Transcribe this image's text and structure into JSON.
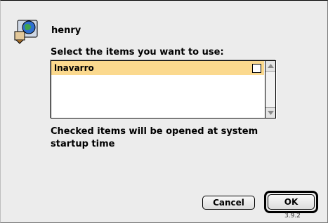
{
  "user": {
    "name": "henry"
  },
  "prompt": "Select the items you want to use:",
  "list": {
    "items": [
      {
        "label": "lnavarro",
        "checked": false,
        "selected": true
      }
    ]
  },
  "help_text": "Checked items will be opened at system startup time",
  "buttons": {
    "cancel": "Cancel",
    "ok": "OK"
  },
  "version": "3.9.2",
  "colors": {
    "selection": "#fbd98e",
    "background": "#ececec"
  }
}
